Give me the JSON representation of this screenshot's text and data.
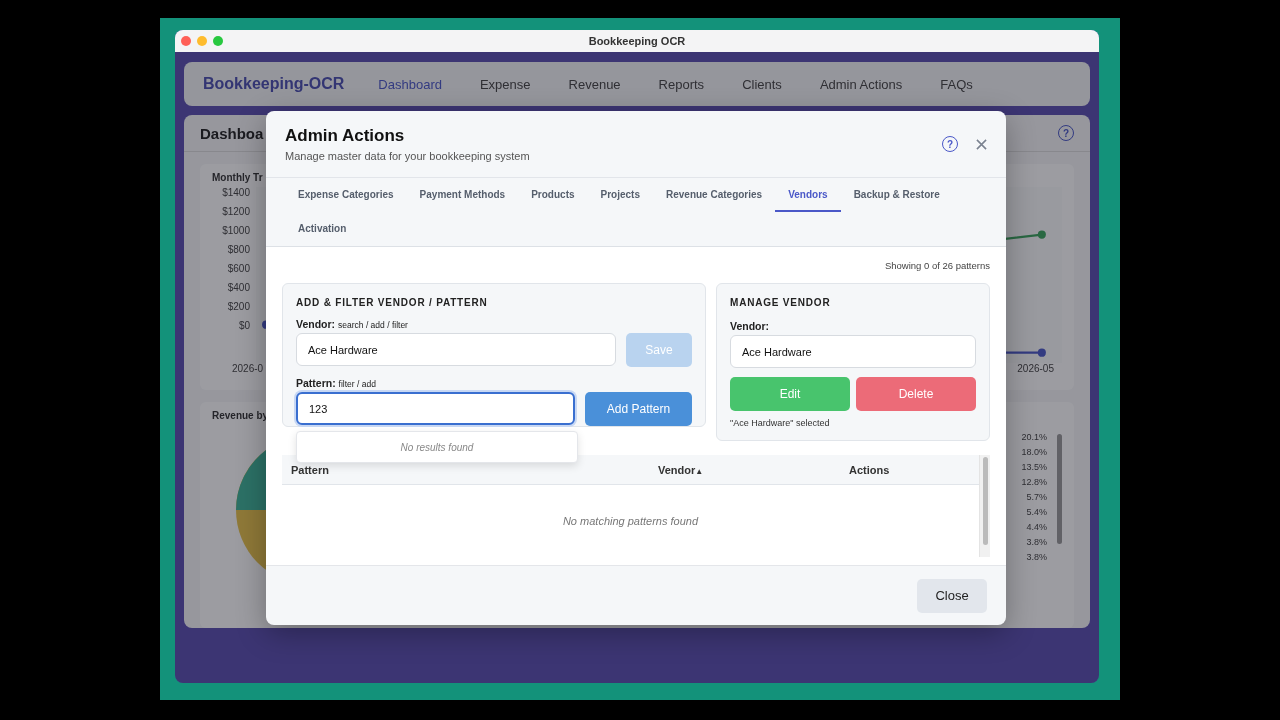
{
  "window": {
    "title": "Bookkeeping OCR"
  },
  "nav": {
    "brand": "Bookkeeping-OCR",
    "items": [
      {
        "label": "Dashboard",
        "selected": true
      },
      {
        "label": "Expense",
        "selected": false
      },
      {
        "label": "Revenue",
        "selected": false
      },
      {
        "label": "Reports",
        "selected": false
      },
      {
        "label": "Clients",
        "selected": false
      },
      {
        "label": "Admin Actions",
        "selected": false
      },
      {
        "label": "FAQs",
        "selected": false
      }
    ]
  },
  "dashboard": {
    "title": "Dashboa",
    "help_icon": "?",
    "trend_panel": {
      "title": "Monthly Tr",
      "y_labels": [
        "$1400",
        "$1200",
        "$1000",
        "$800",
        "$600",
        "$400",
        "$200",
        "$0"
      ],
      "x_first": "2026-0",
      "x_last": "2026-05"
    },
    "revenue_panel": {
      "title": "Revenue by",
      "percentages": [
        "20.1%",
        "18.0%",
        "13.5%",
        "12.8%",
        "5.7%",
        "5.4%",
        "4.4%",
        "3.8%",
        "3.8%"
      ]
    }
  },
  "modal": {
    "title": "Admin Actions",
    "subtitle": "Manage master data for your bookkeeping system",
    "tabs": [
      {
        "label": "Expense Categories",
        "selected": false
      },
      {
        "label": "Payment Methods",
        "selected": false
      },
      {
        "label": "Products",
        "selected": false
      },
      {
        "label": "Projects",
        "selected": false
      },
      {
        "label": "Revenue Categories",
        "selected": false
      },
      {
        "label": "Vendors",
        "selected": true
      },
      {
        "label": "Backup & Restore",
        "selected": false
      },
      {
        "label": "Activation",
        "selected": false
      }
    ],
    "status": "Showing 0 of 26 patterns",
    "add_filter": {
      "heading": "ADD & FILTER VENDOR / PATTERN",
      "vendor_label": "Vendor:",
      "vendor_hint": "search / add / filter",
      "vendor_value": "Ace Hardware",
      "save_button": {
        "label": "Save",
        "disabled": true
      },
      "pattern_label": "Pattern:",
      "pattern_hint": "filter / add",
      "pattern_value": "123",
      "pattern_focused": true,
      "add_button": "Add Pattern",
      "dropdown_message": "No results found"
    },
    "manage": {
      "heading": "MANAGE VENDOR",
      "vendor_label": "Vendor:",
      "vendor_value": "Ace Hardware",
      "edit_button": "Edit",
      "delete_button": "Delete",
      "note": "\"Ace Hardware\" selected"
    },
    "table": {
      "columns": [
        {
          "label": "Pattern"
        },
        {
          "label": "Vendor",
          "sort_mark": "▲"
        },
        {
          "label": "Actions"
        }
      ],
      "empty_message": "No matching patterns found"
    },
    "help_icon": "?",
    "close_button": "Close"
  }
}
